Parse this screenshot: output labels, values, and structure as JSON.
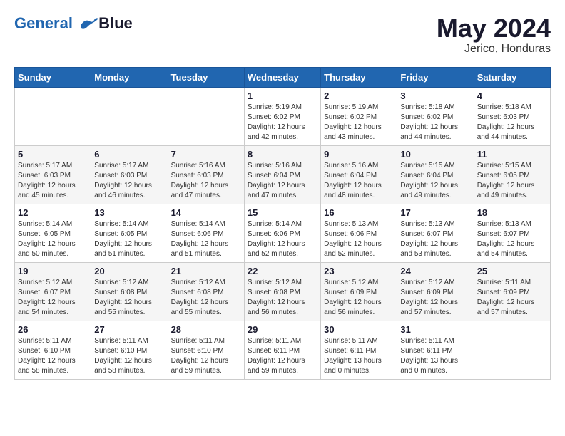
{
  "header": {
    "logo_line1": "General",
    "logo_line2": "Blue",
    "month_year": "May 2024",
    "location": "Jerico, Honduras"
  },
  "weekdays": [
    "Sunday",
    "Monday",
    "Tuesday",
    "Wednesday",
    "Thursday",
    "Friday",
    "Saturday"
  ],
  "weeks": [
    [
      {
        "day": "",
        "info": ""
      },
      {
        "day": "",
        "info": ""
      },
      {
        "day": "",
        "info": ""
      },
      {
        "day": "1",
        "info": "Sunrise: 5:19 AM\nSunset: 6:02 PM\nDaylight: 12 hours\nand 42 minutes."
      },
      {
        "day": "2",
        "info": "Sunrise: 5:19 AM\nSunset: 6:02 PM\nDaylight: 12 hours\nand 43 minutes."
      },
      {
        "day": "3",
        "info": "Sunrise: 5:18 AM\nSunset: 6:02 PM\nDaylight: 12 hours\nand 44 minutes."
      },
      {
        "day": "4",
        "info": "Sunrise: 5:18 AM\nSunset: 6:03 PM\nDaylight: 12 hours\nand 44 minutes."
      }
    ],
    [
      {
        "day": "5",
        "info": "Sunrise: 5:17 AM\nSunset: 6:03 PM\nDaylight: 12 hours\nand 45 minutes."
      },
      {
        "day": "6",
        "info": "Sunrise: 5:17 AM\nSunset: 6:03 PM\nDaylight: 12 hours\nand 46 minutes."
      },
      {
        "day": "7",
        "info": "Sunrise: 5:16 AM\nSunset: 6:03 PM\nDaylight: 12 hours\nand 47 minutes."
      },
      {
        "day": "8",
        "info": "Sunrise: 5:16 AM\nSunset: 6:04 PM\nDaylight: 12 hours\nand 47 minutes."
      },
      {
        "day": "9",
        "info": "Sunrise: 5:16 AM\nSunset: 6:04 PM\nDaylight: 12 hours\nand 48 minutes."
      },
      {
        "day": "10",
        "info": "Sunrise: 5:15 AM\nSunset: 6:04 PM\nDaylight: 12 hours\nand 49 minutes."
      },
      {
        "day": "11",
        "info": "Sunrise: 5:15 AM\nSunset: 6:05 PM\nDaylight: 12 hours\nand 49 minutes."
      }
    ],
    [
      {
        "day": "12",
        "info": "Sunrise: 5:14 AM\nSunset: 6:05 PM\nDaylight: 12 hours\nand 50 minutes."
      },
      {
        "day": "13",
        "info": "Sunrise: 5:14 AM\nSunset: 6:05 PM\nDaylight: 12 hours\nand 51 minutes."
      },
      {
        "day": "14",
        "info": "Sunrise: 5:14 AM\nSunset: 6:06 PM\nDaylight: 12 hours\nand 51 minutes."
      },
      {
        "day": "15",
        "info": "Sunrise: 5:14 AM\nSunset: 6:06 PM\nDaylight: 12 hours\nand 52 minutes."
      },
      {
        "day": "16",
        "info": "Sunrise: 5:13 AM\nSunset: 6:06 PM\nDaylight: 12 hours\nand 52 minutes."
      },
      {
        "day": "17",
        "info": "Sunrise: 5:13 AM\nSunset: 6:07 PM\nDaylight: 12 hours\nand 53 minutes."
      },
      {
        "day": "18",
        "info": "Sunrise: 5:13 AM\nSunset: 6:07 PM\nDaylight: 12 hours\nand 54 minutes."
      }
    ],
    [
      {
        "day": "19",
        "info": "Sunrise: 5:12 AM\nSunset: 6:07 PM\nDaylight: 12 hours\nand 54 minutes."
      },
      {
        "day": "20",
        "info": "Sunrise: 5:12 AM\nSunset: 6:08 PM\nDaylight: 12 hours\nand 55 minutes."
      },
      {
        "day": "21",
        "info": "Sunrise: 5:12 AM\nSunset: 6:08 PM\nDaylight: 12 hours\nand 55 minutes."
      },
      {
        "day": "22",
        "info": "Sunrise: 5:12 AM\nSunset: 6:08 PM\nDaylight: 12 hours\nand 56 minutes."
      },
      {
        "day": "23",
        "info": "Sunrise: 5:12 AM\nSunset: 6:09 PM\nDaylight: 12 hours\nand 56 minutes."
      },
      {
        "day": "24",
        "info": "Sunrise: 5:12 AM\nSunset: 6:09 PM\nDaylight: 12 hours\nand 57 minutes."
      },
      {
        "day": "25",
        "info": "Sunrise: 5:11 AM\nSunset: 6:09 PM\nDaylight: 12 hours\nand 57 minutes."
      }
    ],
    [
      {
        "day": "26",
        "info": "Sunrise: 5:11 AM\nSunset: 6:10 PM\nDaylight: 12 hours\nand 58 minutes."
      },
      {
        "day": "27",
        "info": "Sunrise: 5:11 AM\nSunset: 6:10 PM\nDaylight: 12 hours\nand 58 minutes."
      },
      {
        "day": "28",
        "info": "Sunrise: 5:11 AM\nSunset: 6:10 PM\nDaylight: 12 hours\nand 59 minutes."
      },
      {
        "day": "29",
        "info": "Sunrise: 5:11 AM\nSunset: 6:11 PM\nDaylight: 12 hours\nand 59 minutes."
      },
      {
        "day": "30",
        "info": "Sunrise: 5:11 AM\nSunset: 6:11 PM\nDaylight: 13 hours\nand 0 minutes."
      },
      {
        "day": "31",
        "info": "Sunrise: 5:11 AM\nSunset: 6:11 PM\nDaylight: 13 hours\nand 0 minutes."
      },
      {
        "day": "",
        "info": ""
      }
    ]
  ]
}
